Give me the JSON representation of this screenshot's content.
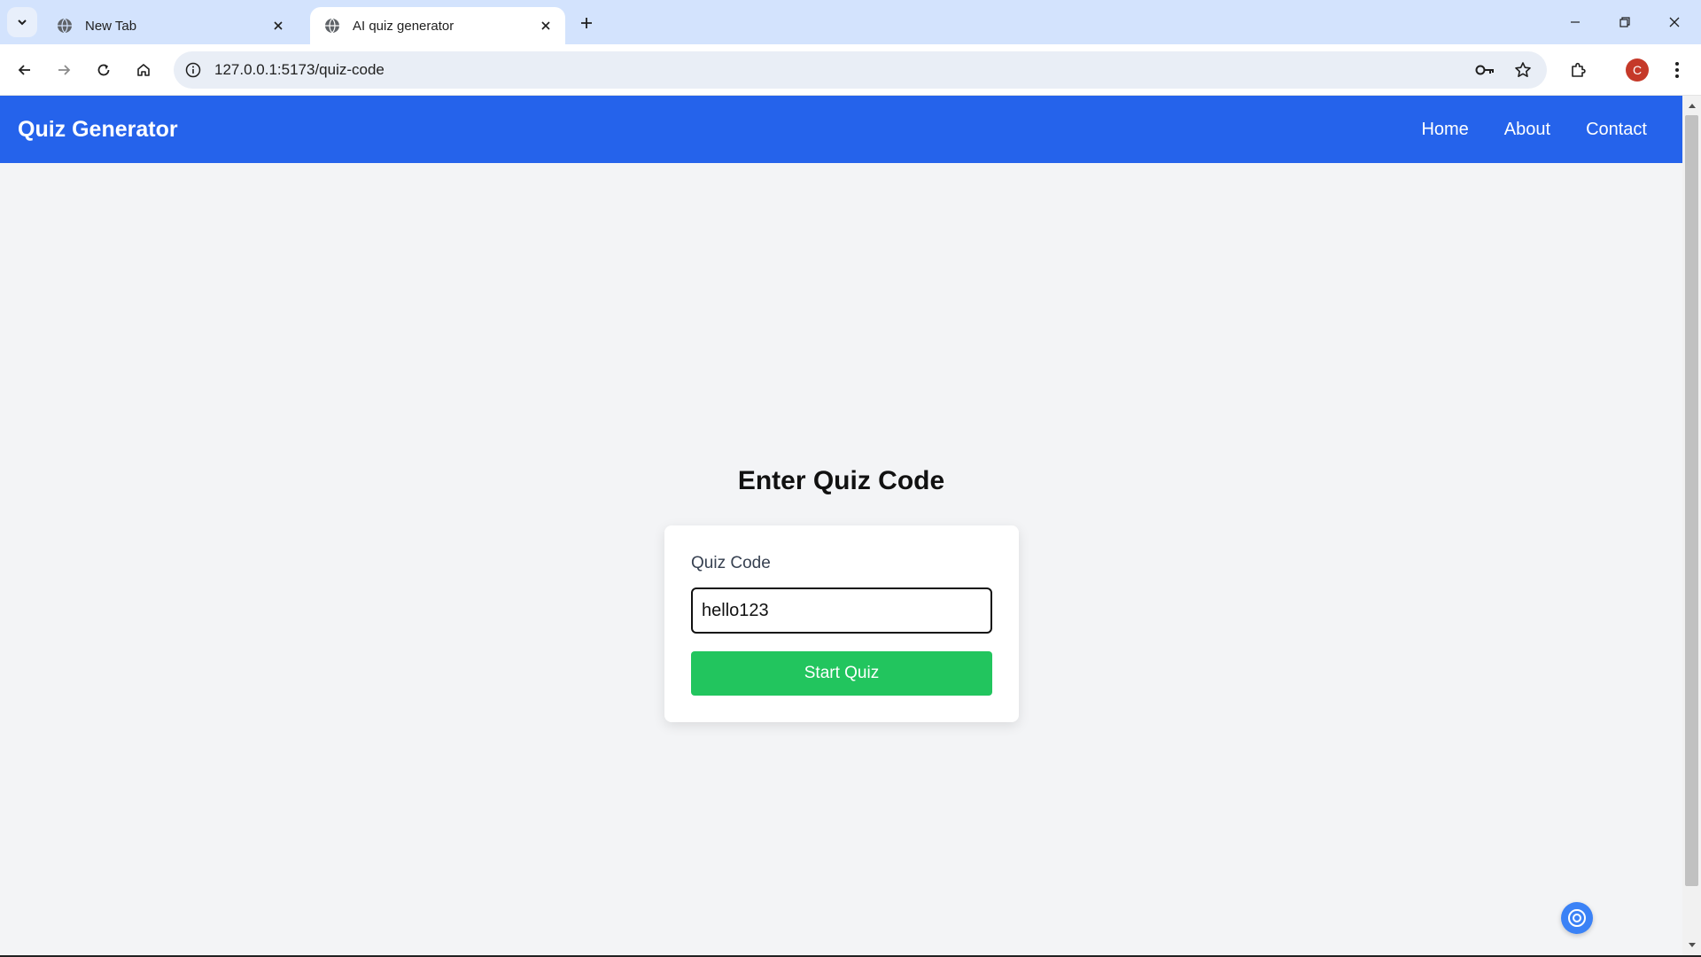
{
  "browser": {
    "tabs": [
      {
        "title": "New Tab",
        "active": false
      },
      {
        "title": "AI quiz generator",
        "active": true
      }
    ],
    "url": "127.0.0.1:5173/quiz-code",
    "profile_initial": "C"
  },
  "navbar": {
    "brand": "Quiz Generator",
    "links": [
      "Home",
      "About",
      "Contact"
    ]
  },
  "main": {
    "heading": "Enter Quiz Code",
    "form": {
      "label": "Quiz Code",
      "input_value": "hello123",
      "submit_label": "Start Quiz"
    }
  },
  "colors": {
    "navbar": "#2563eb",
    "button": "#22c55e",
    "page_bg": "#f3f4f6"
  }
}
